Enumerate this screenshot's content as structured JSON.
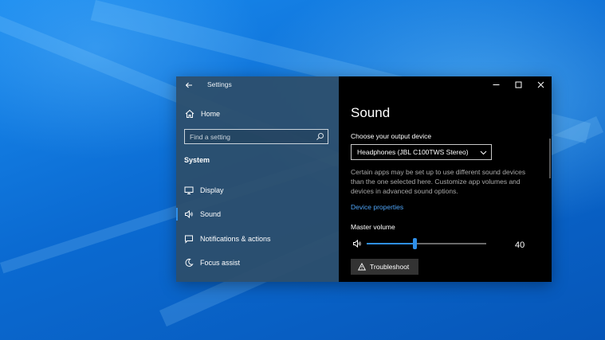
{
  "window": {
    "app_title": "Settings"
  },
  "sidebar": {
    "home_label": "Home",
    "search_placeholder": "Find a setting",
    "section_title": "System",
    "items": [
      {
        "label": "Display",
        "icon": "monitor-icon",
        "selected": false
      },
      {
        "label": "Sound",
        "icon": "speaker-icon",
        "selected": true
      },
      {
        "label": "Notifications & actions",
        "icon": "message-icon",
        "selected": false
      },
      {
        "label": "Focus assist",
        "icon": "moon-icon",
        "selected": false
      }
    ]
  },
  "content": {
    "title": "Sound",
    "output_label": "Choose your output device",
    "output_device": "Headphones (JBL C100TWS Stereo)",
    "description": "Certain apps may be set up to use different sound devices than the one selected here. Customize app volumes and devices in advanced sound options.",
    "device_properties_link": "Device properties",
    "master_volume_label": "Master volume",
    "master_volume_value": "40",
    "volume_level_percent": 40,
    "troubleshoot_label": "Troubleshoot"
  },
  "colors": {
    "accent": "#2f8fe8",
    "link": "#4ea3f5",
    "sidebar_bg": "#2d4e69",
    "content_bg": "#000000"
  }
}
